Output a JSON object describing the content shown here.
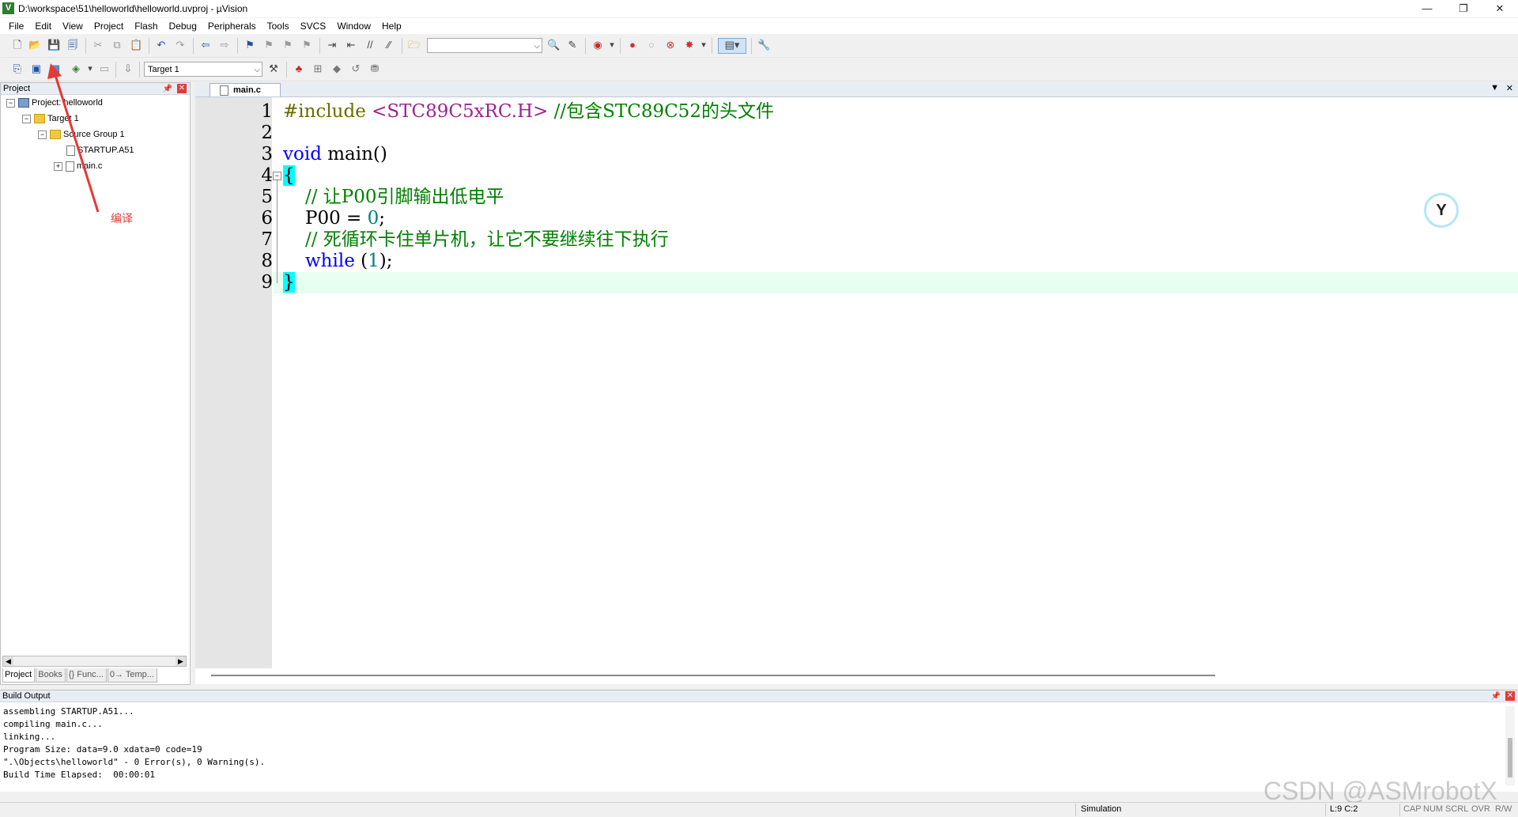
{
  "window": {
    "title": "D:\\workspace\\51\\helloworld\\helloworld.uvproj - µVision",
    "app_icon": "V",
    "controls": {
      "minimize": "—",
      "restore": "❐",
      "close": "✕"
    }
  },
  "menu": [
    "File",
    "Edit",
    "View",
    "Project",
    "Flash",
    "Debug",
    "Peripherals",
    "Tools",
    "SVCS",
    "Window",
    "Help"
  ],
  "toolbar2": {
    "target_select": "Target 1"
  },
  "project_panel": {
    "title": "Project",
    "tree": [
      {
        "label": "Project: helloworld",
        "icon": "project-icon",
        "expander": "−"
      },
      {
        "label": "Target 1",
        "icon": "target-folder-icon",
        "expander": "−"
      },
      {
        "label": "Source Group 1",
        "icon": "folder-icon",
        "expander": "−"
      },
      {
        "label": "STARTUP.A51",
        "icon": "file-icon"
      },
      {
        "label": "main.c",
        "icon": "file-icon",
        "expander": "+"
      }
    ],
    "tabs": [
      "Project",
      "Books",
      "{} Func...",
      "0→ Temp..."
    ]
  },
  "annotation": {
    "label": "编译",
    "color": "#e53935"
  },
  "editor": {
    "active_tab": "main.c",
    "line_numbers": [
      "1",
      "2",
      "3",
      "4",
      "5",
      "6",
      "7",
      "8",
      "9"
    ],
    "lines": {
      "l1_directive": "#include",
      "l1_header": "<STC89C5xRC.H>",
      "l1_comment": "//包含STC89C52的头文件",
      "l3_kw": "void",
      "l3_rest": "main()",
      "l4_brace": "{",
      "l5_comment": "// 让P00引脚输出低电平",
      "l6_lhs": "P00 = ",
      "l6_num": "0",
      "l6_end": ";",
      "l7_comment": "// 死循环卡住单片机，让它不要继续往下执行",
      "l8_kw": "while",
      "l8_open": " (",
      "l8_num": "1",
      "l8_close": ");",
      "l9_brace": "}"
    },
    "colors": {
      "keyword": "#0000ff",
      "comment": "#008000",
      "number": "#008080",
      "current_line": "#e6fff0",
      "brace_match": "#00ffff"
    }
  },
  "build_output": {
    "title": "Build Output",
    "lines": [
      "assembling STARTUP.A51...",
      "compiling main.c...",
      "linking...",
      "Program Size: data=9.0 xdata=0 code=19",
      "\".\\Objects\\helloworld\" - 0 Error(s), 0 Warning(s).",
      "Build Time Elapsed:  00:00:01"
    ]
  },
  "watermark": "CSDN @ASMrobotX",
  "statusbar": {
    "mode": "Simulation",
    "position": "L:9 C:2",
    "indicators": [
      "CAP",
      "NUM",
      "SCRL",
      "OVR",
      "R/W"
    ]
  }
}
